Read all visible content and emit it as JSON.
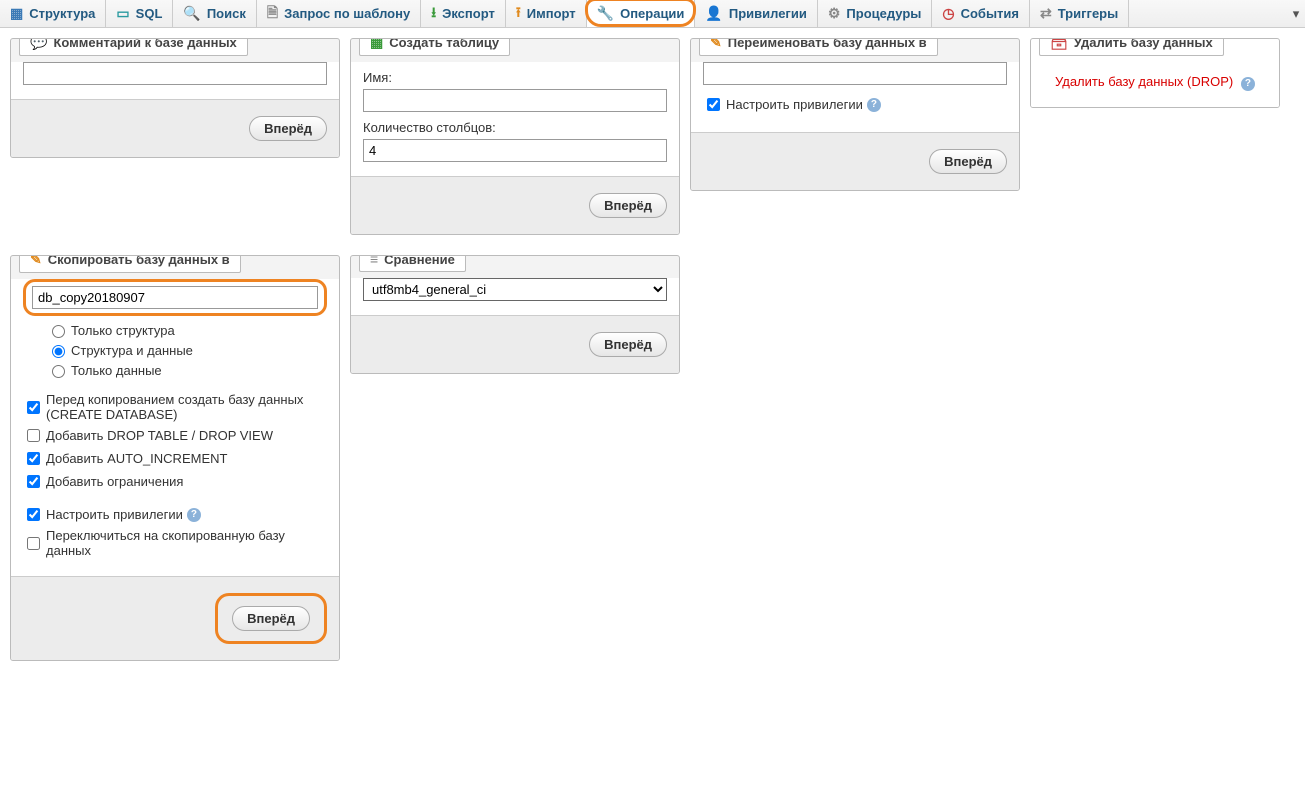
{
  "tabs": {
    "structure": "Структура",
    "sql": "SQL",
    "search": "Поиск",
    "query": "Запрос по шаблону",
    "export": "Экспорт",
    "import": "Импорт",
    "operations": "Операции",
    "privileges": "Привилегии",
    "routines": "Процедуры",
    "events": "События",
    "triggers": "Триггеры"
  },
  "buttons": {
    "go": "Вперёд"
  },
  "comment_panel": {
    "title": "Комментарий к базе данных",
    "value": ""
  },
  "create_table_panel": {
    "title": "Создать таблицу",
    "name_label": "Имя:",
    "name_value": "",
    "cols_label": "Количество столбцов:",
    "cols_value": "4"
  },
  "rename_panel": {
    "title": "Переименовать базу данных в",
    "value": "",
    "adjust_priv_label": "Настроить привилегии"
  },
  "drop_panel": {
    "title": "Удалить базу данных",
    "link": "Удалить базу данных (DROP)"
  },
  "copy_panel": {
    "title": "Скопировать базу данных в",
    "value": "db_copy20180907",
    "opt_structure_only": "Только структура",
    "opt_structure_data": "Структура и данные",
    "opt_data_only": "Только данные",
    "chk_create_db": "Перед копированием создать базу данных (CREATE DATABASE)",
    "chk_drop": "Добавить DROP TABLE / DROP VIEW",
    "chk_autoinc": "Добавить AUTO_INCREMENT",
    "chk_constraints": "Добавить ограничения",
    "chk_adjust_priv": "Настроить привилегии",
    "chk_switch": "Переключиться на скопированную базу данных"
  },
  "collation_panel": {
    "title": "Сравнение",
    "value": "utf8mb4_general_ci"
  }
}
